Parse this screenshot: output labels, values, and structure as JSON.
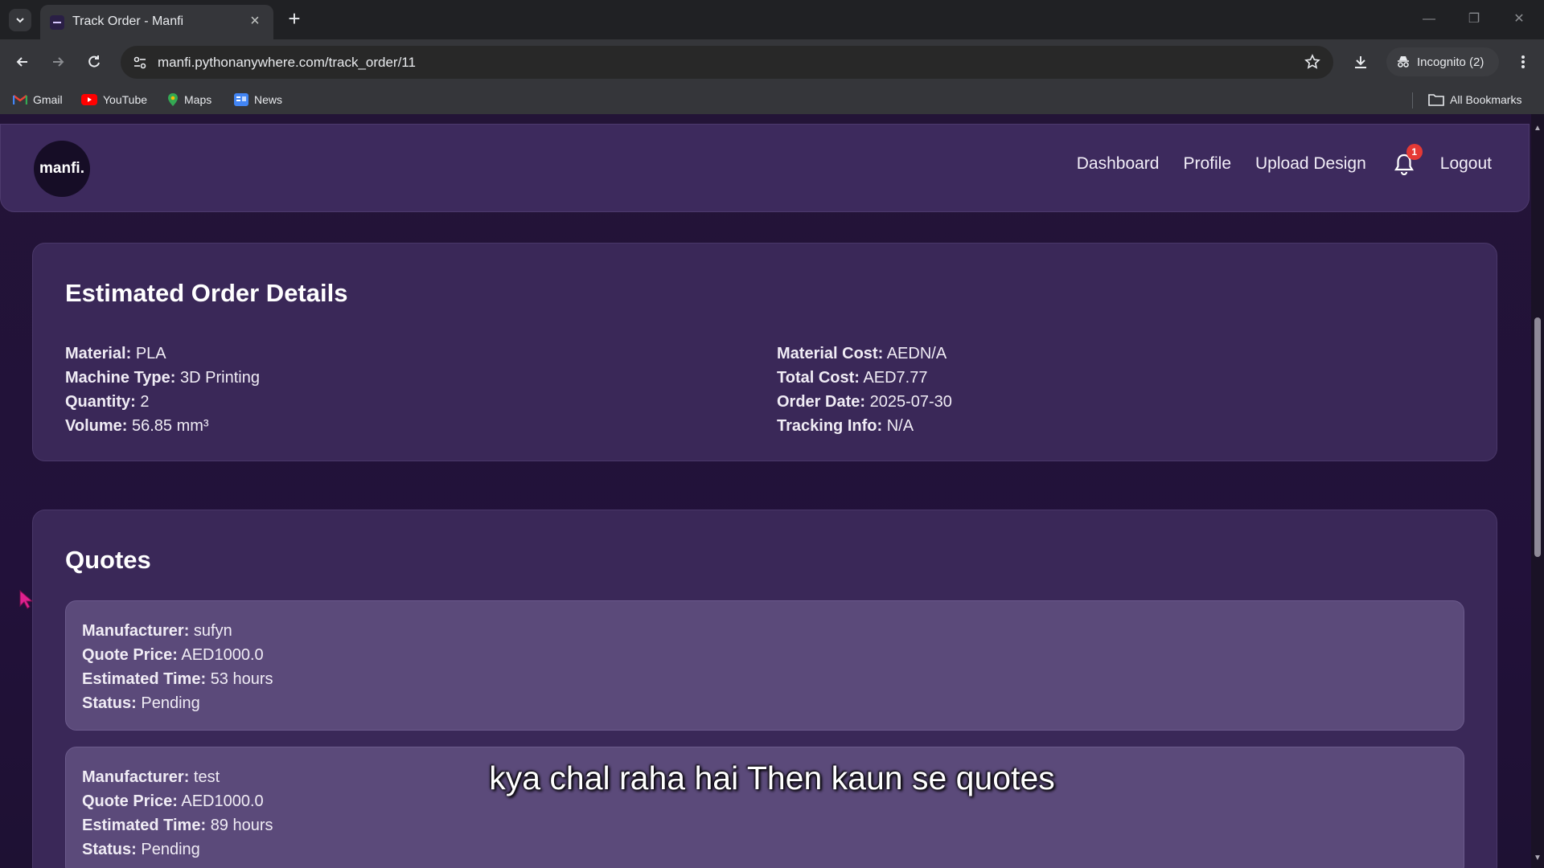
{
  "browser": {
    "tab_title": "Track Order - Manfi",
    "url": "manfi.pythonanywhere.com/track_order/11",
    "incognito_label": "Incognito (2)",
    "bookmarks": [
      "Gmail",
      "YouTube",
      "Maps",
      "News"
    ],
    "all_bookmarks_label": "All Bookmarks"
  },
  "site": {
    "logo_text": "manfi.",
    "nav": [
      "Dashboard",
      "Profile",
      "Upload Design",
      "Logout"
    ],
    "notification_count": "1"
  },
  "order": {
    "title": "Estimated Order Details",
    "left": [
      {
        "label": "Material:",
        "value": "PLA"
      },
      {
        "label": "Machine Type:",
        "value": "3D Printing"
      },
      {
        "label": "Quantity:",
        "value": "2"
      },
      {
        "label": "Volume:",
        "value": "56.85 mm³"
      }
    ],
    "right": [
      {
        "label": "Material Cost:",
        "value": "AEDN/A"
      },
      {
        "label": "Total Cost:",
        "value": "AED7.77"
      },
      {
        "label": "Order Date:",
        "value": "2025-07-30"
      },
      {
        "label": "Tracking Info:",
        "value": "N/A"
      }
    ]
  },
  "quotes": {
    "title": "Quotes",
    "items": [
      {
        "rows": [
          {
            "label": "Manufacturer:",
            "value": "sufyn"
          },
          {
            "label": "Quote Price:",
            "value": "AED1000.0"
          },
          {
            "label": "Estimated Time:",
            "value": "53 hours"
          },
          {
            "label": "Status:",
            "value": "Pending"
          }
        ]
      },
      {
        "rows": [
          {
            "label": "Manufacturer:",
            "value": "test"
          },
          {
            "label": "Quote Price:",
            "value": "AED1000.0"
          },
          {
            "label": "Estimated Time:",
            "value": "89 hours"
          },
          {
            "label": "Status:",
            "value": "Pending"
          }
        ]
      }
    ]
  },
  "subtitle": "kya chal raha hai Then kaun se quotes"
}
